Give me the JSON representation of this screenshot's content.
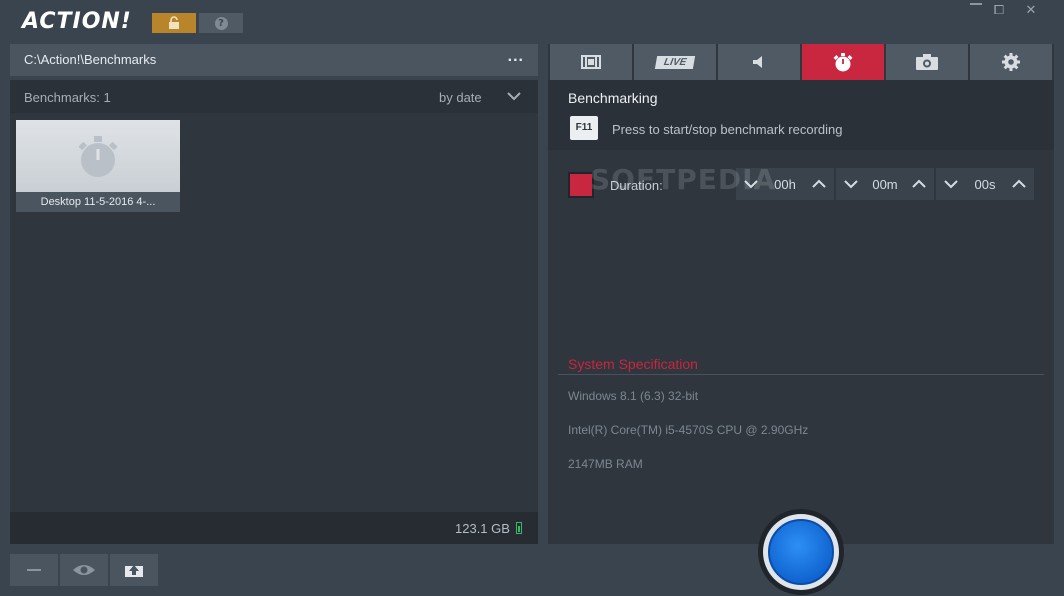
{
  "app": {
    "logo": "ACTION!"
  },
  "window_controls": {
    "minimize": "",
    "restore": "⧠",
    "close": "✕"
  },
  "left": {
    "path": "C:\\Action!\\Benchmarks",
    "path_more": "...",
    "bench_count": "Benchmarks: 1",
    "sort_label": "by date",
    "items": [
      {
        "label": "Desktop 11-5-2016 4-..."
      }
    ],
    "storage": "123.1 GB"
  },
  "tabs": [
    {
      "name": "video",
      "icon": "film-icon"
    },
    {
      "name": "live",
      "label": "LIVE",
      "icon": "live-icon"
    },
    {
      "name": "audio",
      "icon": "speaker-icon"
    },
    {
      "name": "benchmark",
      "icon": "stopwatch-icon",
      "active": true
    },
    {
      "name": "screenshot",
      "icon": "camera-icon"
    },
    {
      "name": "settings",
      "icon": "gear-icon"
    }
  ],
  "benchmark": {
    "title": "Benchmarking",
    "key": "F11",
    "hint": "Press to start/stop benchmark recording",
    "duration_label": "Duration:",
    "hours": "00h",
    "minutes": "00m",
    "seconds": "00s"
  },
  "system": {
    "title": "System Specification",
    "os": "Windows 8.1 (6.3) 32-bit",
    "cpu": "Intel(R) Core(TM) i5-4570S CPU @ 2.90GHz",
    "ram": "2147MB RAM"
  },
  "watermark": "SOFTPEDIA",
  "colors": {
    "accent": "#c9263f",
    "lock": "#b8852a",
    "record": "#0e62cf"
  }
}
